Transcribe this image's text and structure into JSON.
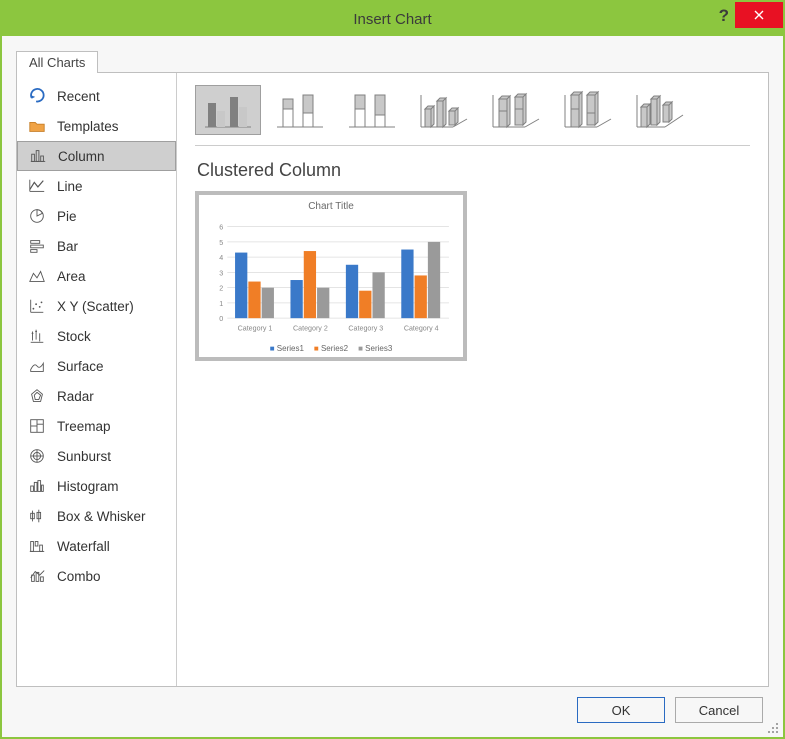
{
  "window": {
    "title": "Insert Chart"
  },
  "tabs": {
    "all_charts": "All Charts"
  },
  "sidebar": {
    "items": [
      {
        "label": "Recent"
      },
      {
        "label": "Templates"
      },
      {
        "label": "Column"
      },
      {
        "label": "Line"
      },
      {
        "label": "Pie"
      },
      {
        "label": "Bar"
      },
      {
        "label": "Area"
      },
      {
        "label": "X Y (Scatter)"
      },
      {
        "label": "Stock"
      },
      {
        "label": "Surface"
      },
      {
        "label": "Radar"
      },
      {
        "label": "Treemap"
      },
      {
        "label": "Sunburst"
      },
      {
        "label": "Histogram"
      },
      {
        "label": "Box & Whisker"
      },
      {
        "label": "Waterfall"
      },
      {
        "label": "Combo"
      }
    ],
    "selected_index": 2
  },
  "column_subtypes": {
    "selected_index": 0,
    "items": [
      "clustered-column",
      "stacked-column",
      "100-percent-stacked-column",
      "3d-clustered-column",
      "3d-stacked-column",
      "3d-100-percent-stacked-column",
      "3d-column"
    ]
  },
  "chart_heading": "Clustered Column",
  "preview": {
    "title": "Chart Title",
    "legend": [
      "Series1",
      "Series2",
      "Series3"
    ]
  },
  "footer": {
    "ok": "OK",
    "cancel": "Cancel"
  },
  "colors": {
    "accent": "#8cc63f",
    "close": "#e81123",
    "series1": "#3a79c9",
    "series2": "#f07e26",
    "series3": "#9a9a9a"
  },
  "chart_data": {
    "type": "bar",
    "title": "Chart Title",
    "categories": [
      "Category 1",
      "Category 2",
      "Category 3",
      "Category 4"
    ],
    "series": [
      {
        "name": "Series1",
        "values": [
          4.3,
          2.5,
          3.5,
          4.5
        ]
      },
      {
        "name": "Series2",
        "values": [
          2.4,
          4.4,
          1.8,
          2.8
        ]
      },
      {
        "name": "Series3",
        "values": [
          2.0,
          2.0,
          3.0,
          5.0
        ]
      }
    ],
    "xlabel": "",
    "ylabel": "",
    "ylim": [
      0,
      6
    ],
    "yticks": [
      0,
      1,
      2,
      3,
      4,
      5,
      6
    ],
    "grid": true,
    "legend_position": "bottom"
  }
}
